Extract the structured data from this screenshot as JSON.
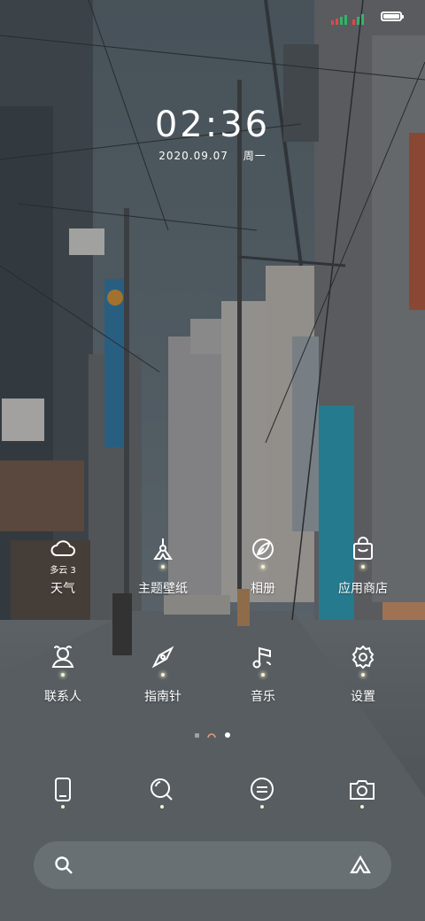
{
  "status_bar": {
    "battery_level": 1.0
  },
  "clock": {
    "time": "02:36",
    "date": "2020.09.07",
    "weekday": "周一"
  },
  "home_apps": [
    {
      "id": "weather",
      "label": "天气",
      "sub": "多云 3",
      "icon": "cloud-icon"
    },
    {
      "id": "theme",
      "label": "主题壁纸",
      "icon": "theme-brush-icon"
    },
    {
      "id": "gallery",
      "label": "相册",
      "icon": "leaf-photo-icon"
    },
    {
      "id": "appstore",
      "label": "应用商店",
      "icon": "shopping-bag-icon"
    },
    {
      "id": "contacts",
      "label": "联系人",
      "icon": "contact-person-icon"
    },
    {
      "id": "compass",
      "label": "指南针",
      "icon": "compass-icon"
    },
    {
      "id": "music",
      "label": "音乐",
      "icon": "music-note-icon"
    },
    {
      "id": "settings",
      "label": "设置",
      "icon": "gear-icon"
    }
  ],
  "dock": [
    {
      "id": "phone",
      "icon": "phone-icon"
    },
    {
      "id": "browser",
      "icon": "search-browser-icon"
    },
    {
      "id": "messages",
      "icon": "message-icon"
    },
    {
      "id": "camera",
      "icon": "camera-icon"
    }
  ],
  "page_indicator": {
    "pages": 3,
    "current": 3
  },
  "colors": {
    "icon": "#ffffff",
    "glow": "#f4f1cf",
    "sky": "#6f7b84",
    "teal_sign": "#2aa8c4"
  }
}
